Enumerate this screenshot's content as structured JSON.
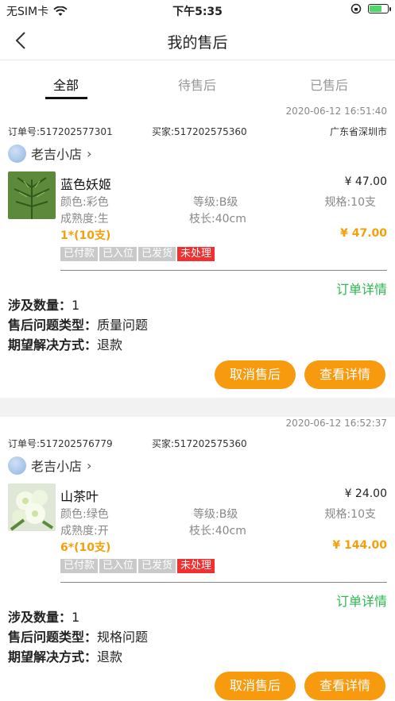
{
  "status": {
    "carrier": "无SIM卡",
    "time": "下午5:35"
  },
  "nav": {
    "title": "我的售后"
  },
  "tabs": [
    {
      "label": "全部",
      "active": true
    },
    {
      "label": "待售后",
      "active": false
    },
    {
      "label": "已售后",
      "active": false
    }
  ],
  "orders": [
    {
      "date": "2020-06-12 16:51:40",
      "order_no": "订单号:517202577301",
      "buyer": "买家:517202575360",
      "region": "广东省深圳市",
      "shop": "老吉小店",
      "product": {
        "name": "蓝色妖姬",
        "unit_price": "¥ 47.00",
        "color": "颜色:彩色",
        "grade": "等级:B级",
        "spec": "规格:10支",
        "ripeness": "成熟度:生",
        "stem": "枝长:40cm",
        "qty": "1*(10支)",
        "total": "¥ 47.00"
      },
      "badges": [
        "已付款",
        "已入位",
        "已发货",
        "未处理"
      ],
      "detail_link": "订单详情",
      "info": {
        "count_label": "涉及数量：",
        "count": "1",
        "type_label": "售后问题类型：",
        "type": "质量问题",
        "resolve_label": "期望解决方式：",
        "resolve": "退款"
      },
      "buttons": {
        "cancel": "取消售后",
        "view": "查看详情"
      }
    },
    {
      "date": "2020-06-12 16:52:37",
      "order_no": "订单号:517202576779",
      "buyer": "买家:517202575360",
      "region": "",
      "shop": "老吉小店",
      "product": {
        "name": "山茶叶",
        "unit_price": "¥ 24.00",
        "color": "颜色:绿色",
        "grade": "等级:B级",
        "spec": "规格:10支",
        "ripeness": "成熟度:开",
        "stem": "枝长:40cm",
        "qty": "6*(10支)",
        "total": "¥ 144.00"
      },
      "badges": [
        "已付款",
        "已入位",
        "已发货",
        "未处理"
      ],
      "detail_link": "订单详情",
      "info": {
        "count_label": "涉及数量：",
        "count": "1",
        "type_label": "售后问题类型：",
        "type": "规格问题",
        "resolve_label": "期望解决方式：",
        "resolve": "退款"
      },
      "buttons": {
        "cancel": "取消售后",
        "view": "查看详情"
      }
    }
  ]
}
